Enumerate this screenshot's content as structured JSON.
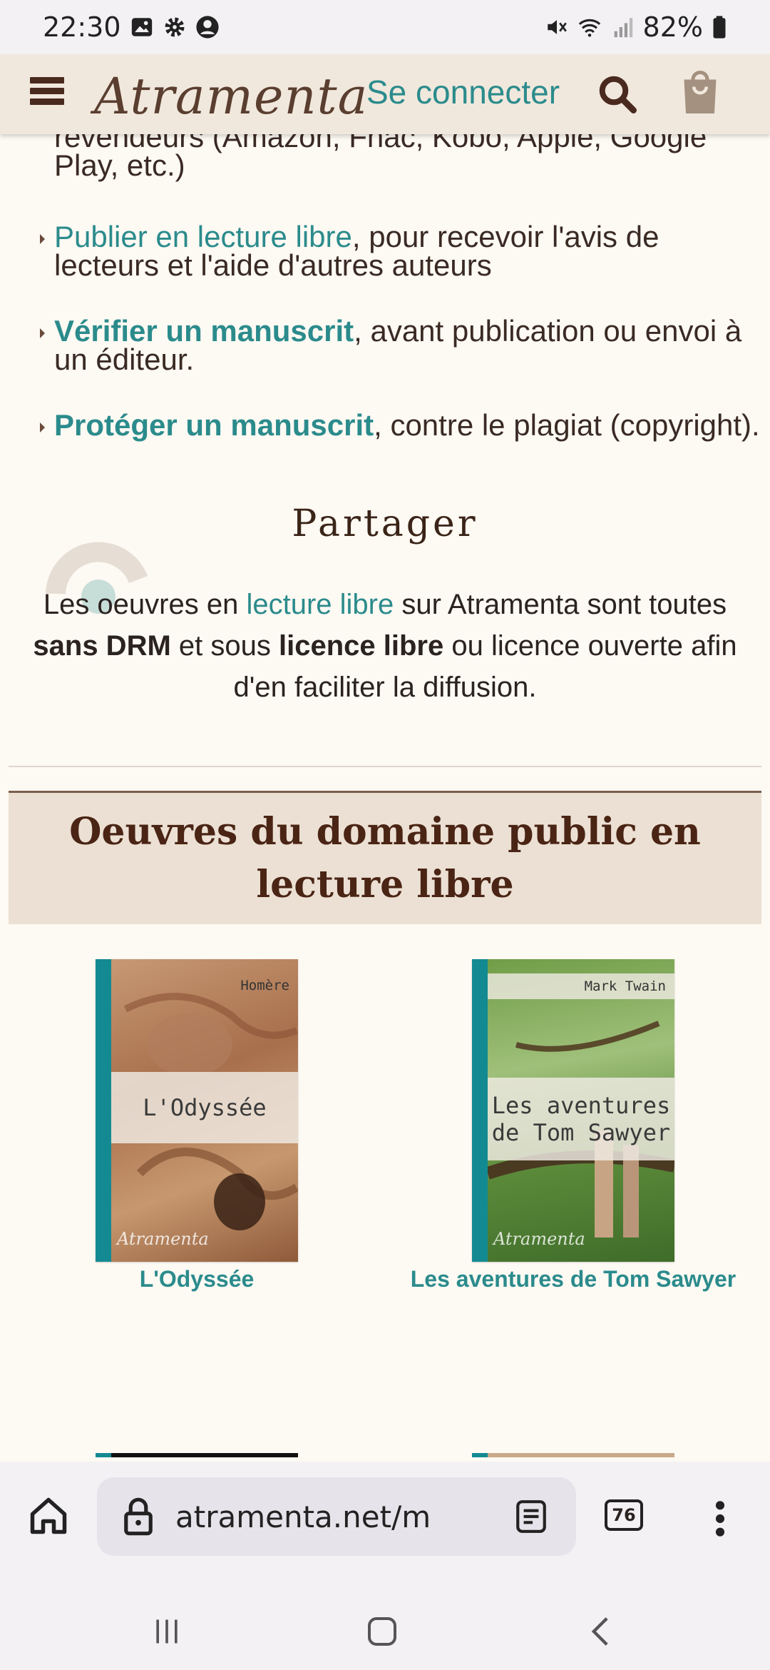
{
  "status_bar": {
    "time": "22:30",
    "battery": "82%",
    "icons_left": [
      "image-icon",
      "gear-icon",
      "account-icon"
    ],
    "icons_right": [
      "mute-icon",
      "wifi-icon",
      "signal-icon",
      "battery-icon"
    ]
  },
  "header": {
    "logo": "Atramenta",
    "login_label": "Se connecter"
  },
  "list": {
    "cut_line_1": "revendeurs (Amazon, Fnac, Kobo, Apple, Google",
    "cut_line_2": "Play, etc.)",
    "item1_link": "Publier en lecture libre",
    "item1_text": ", pour recevoir l'avis de lecteurs et l'aide d'autres auteurs",
    "item2_link": "Vérifier un manuscrit",
    "item2_text": ", avant publication ou envoi à un éditeur.",
    "item3_link": "Protéger un manuscrit",
    "item3_text": ", contre le plagiat (copyright)."
  },
  "share": {
    "title": "Partager",
    "text_1": "Les oeuvres en ",
    "link": "lecture libre",
    "text_2": " sur Atramenta sont toutes ",
    "bold_1": "sans DRM",
    "text_3": " et sous ",
    "bold_2": "licence libre",
    "text_4": " ou licence ouverte afin d'en faciliter la diffusion."
  },
  "public_domain": {
    "heading": "Oeuvres du domaine public en lecture libre",
    "books": [
      {
        "title": "L'Odyssée",
        "cover_author": "Homère",
        "cover_title": "L'Odyssée",
        "cover_mark": "Atramenta"
      },
      {
        "title": "Les aventures de Tom Sawyer",
        "cover_author": "Mark Twain",
        "cover_title": "Les aventures de Tom Sawyer",
        "cover_mark": "Atramenta"
      }
    ]
  },
  "browser": {
    "url": "atramenta.net/m",
    "tab_count": "76"
  },
  "colors": {
    "link": "#2b8b8c",
    "header_bg": "#f1e8dd",
    "section_bg": "#ebe0d3",
    "heading": "#4a2414",
    "page_bg": "#fdf9f3"
  }
}
